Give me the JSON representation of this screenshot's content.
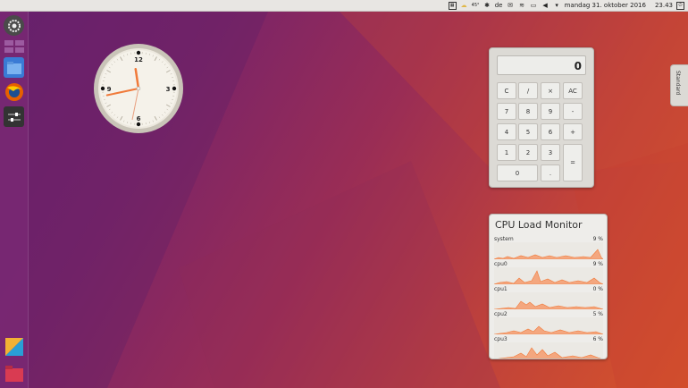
{
  "panel": {
    "temperature": "45°",
    "keyboard_layout": "de",
    "date_time": "mandag 31. oktober 2016",
    "clock": "23.43",
    "icons": [
      "calculator-icon",
      "weather-icon",
      "temperature-icon",
      "bluetooth-icon",
      "keyboard-icon",
      "mail-icon",
      "wifi-icon",
      "battery-icon",
      "volume-icon",
      "power-icon"
    ]
  },
  "launcher": {
    "items": [
      {
        "name": "system-settings-icon"
      },
      {
        "name": "workspaces-icon"
      },
      {
        "name": "files-icon"
      },
      {
        "name": "firefox-icon"
      },
      {
        "name": "settings-icon"
      },
      {
        "name": "software-icon"
      },
      {
        "name": "folder-icon"
      }
    ]
  },
  "clock_widget": {
    "numerals": [
      "12",
      "3",
      "6",
      "9"
    ],
    "hour": 11,
    "minute": 43
  },
  "calculator": {
    "display": "0",
    "keys": [
      "C",
      "/",
      "×",
      "AC",
      "7",
      "8",
      "9",
      "-",
      "4",
      "5",
      "6",
      "+",
      "1",
      "2",
      "3",
      "=",
      "0",
      "."
    ]
  },
  "cpu_monitor": {
    "title": "CPU Load Monitor",
    "rows": [
      {
        "label": "system",
        "value": "9 %"
      },
      {
        "label": "cpu0",
        "value": "9 %"
      },
      {
        "label": "cpu1",
        "value": "0 %"
      },
      {
        "label": "cpu2",
        "value": "5 %"
      },
      {
        "label": "cpu3",
        "value": "6 %"
      }
    ]
  },
  "edge_tab": {
    "label": "Standard"
  },
  "colors": {
    "accent_orange": "#f07a3a",
    "graph_fill": "#f4a77f"
  }
}
